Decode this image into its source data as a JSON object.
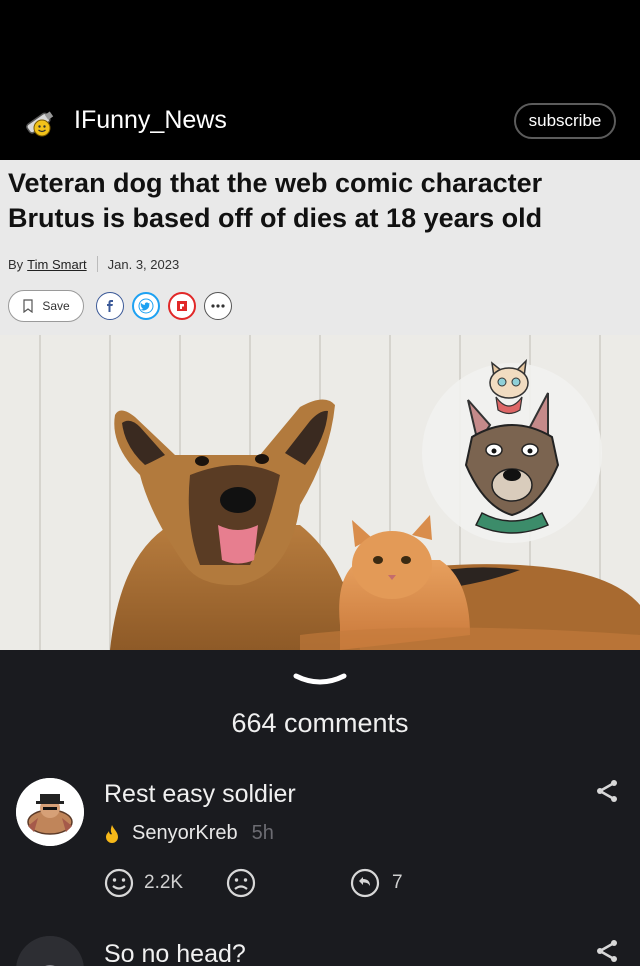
{
  "header": {
    "channel": "IFunny_News",
    "subscribe": "subscribe"
  },
  "article": {
    "headline": "Veteran dog that the web comic character Brutus is based off of dies at 18 years old",
    "by": "By",
    "author": "Tim Smart",
    "date": "Jan. 3, 2023",
    "save": "Save"
  },
  "comments": {
    "count_label": "664 comments",
    "items": [
      {
        "text": "Rest easy soldier",
        "author": "SenyorKreb",
        "time": "5h",
        "likes": "2.2K",
        "replies": "7"
      },
      {
        "text": "So no head?"
      }
    ]
  },
  "colors": {
    "page_bg": "#000000",
    "comments_bg": "#1a1b1f",
    "facebook": "#3b5998",
    "twitter": "#1da1f2",
    "flipboard": "#e12828"
  }
}
